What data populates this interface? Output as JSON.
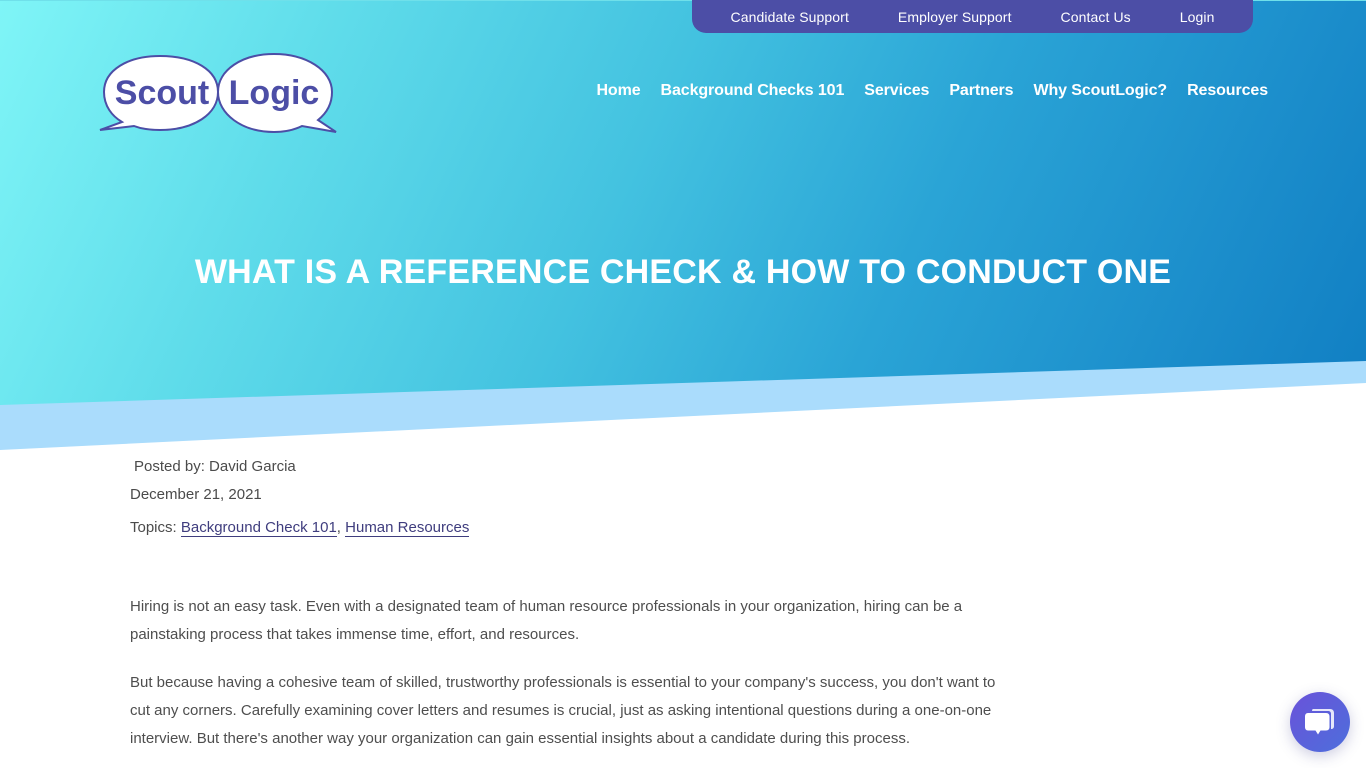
{
  "brand": {
    "logo_words": [
      "Scout",
      "Logic"
    ],
    "colors": {
      "primary_purple": "#4c4ea6",
      "hero_gradient_start": "#7ff5f7",
      "hero_gradient_end": "#0f7dc2",
      "band": "#aadcfc",
      "link": "#3f3d7e"
    }
  },
  "utility_nav": {
    "items": [
      {
        "label": "Candidate Support"
      },
      {
        "label": "Employer Support"
      },
      {
        "label": "Contact Us"
      },
      {
        "label": "Login"
      }
    ]
  },
  "main_nav": {
    "items": [
      {
        "label": "Home"
      },
      {
        "label": "Background Checks 101"
      },
      {
        "label": "Services"
      },
      {
        "label": "Partners"
      },
      {
        "label": "Why ScoutLogic?"
      },
      {
        "label": "Resources"
      }
    ]
  },
  "hero": {
    "title": "What Is a Reference Check & How to Conduct One"
  },
  "post_meta": {
    "posted_by": "Posted by: David Garcia",
    "date": "December 21, 2021",
    "topics_label": "Topics:",
    "topics": [
      {
        "label": "Background Check 101"
      },
      {
        "label": "Human Resources"
      }
    ],
    "separator": ","
  },
  "article": {
    "paragraphs": [
      "Hiring is not an easy task. Even with a designated team of human resource professionals in your organization, hiring can be a painstaking process that takes immense time, effort, and resources.",
      "But because having a cohesive team of skilled, trustworthy professionals is essential to your company's success, you don't want to cut any corners. Carefully examining cover letters and resumes is crucial, just as asking intentional questions during a one-on-one interview. But there's another way your organization can gain essential insights about a candidate during this process."
    ]
  },
  "chat_widget": {
    "icon": "chat-bubbles-icon"
  }
}
